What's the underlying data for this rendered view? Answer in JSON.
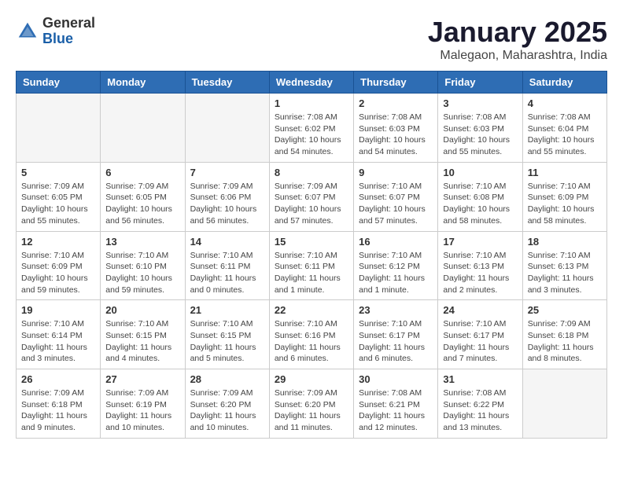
{
  "header": {
    "logo_general": "General",
    "logo_blue": "Blue",
    "title": "January 2025",
    "subtitle": "Malegaon, Maharashtra, India"
  },
  "days_of_week": [
    "Sunday",
    "Monday",
    "Tuesday",
    "Wednesday",
    "Thursday",
    "Friday",
    "Saturday"
  ],
  "weeks": [
    [
      {
        "day": "",
        "info": ""
      },
      {
        "day": "",
        "info": ""
      },
      {
        "day": "",
        "info": ""
      },
      {
        "day": "1",
        "info": "Sunrise: 7:08 AM\nSunset: 6:02 PM\nDaylight: 10 hours\nand 54 minutes."
      },
      {
        "day": "2",
        "info": "Sunrise: 7:08 AM\nSunset: 6:03 PM\nDaylight: 10 hours\nand 54 minutes."
      },
      {
        "day": "3",
        "info": "Sunrise: 7:08 AM\nSunset: 6:03 PM\nDaylight: 10 hours\nand 55 minutes."
      },
      {
        "day": "4",
        "info": "Sunrise: 7:08 AM\nSunset: 6:04 PM\nDaylight: 10 hours\nand 55 minutes."
      }
    ],
    [
      {
        "day": "5",
        "info": "Sunrise: 7:09 AM\nSunset: 6:05 PM\nDaylight: 10 hours\nand 55 minutes."
      },
      {
        "day": "6",
        "info": "Sunrise: 7:09 AM\nSunset: 6:05 PM\nDaylight: 10 hours\nand 56 minutes."
      },
      {
        "day": "7",
        "info": "Sunrise: 7:09 AM\nSunset: 6:06 PM\nDaylight: 10 hours\nand 56 minutes."
      },
      {
        "day": "8",
        "info": "Sunrise: 7:09 AM\nSunset: 6:07 PM\nDaylight: 10 hours\nand 57 minutes."
      },
      {
        "day": "9",
        "info": "Sunrise: 7:10 AM\nSunset: 6:07 PM\nDaylight: 10 hours\nand 57 minutes."
      },
      {
        "day": "10",
        "info": "Sunrise: 7:10 AM\nSunset: 6:08 PM\nDaylight: 10 hours\nand 58 minutes."
      },
      {
        "day": "11",
        "info": "Sunrise: 7:10 AM\nSunset: 6:09 PM\nDaylight: 10 hours\nand 58 minutes."
      }
    ],
    [
      {
        "day": "12",
        "info": "Sunrise: 7:10 AM\nSunset: 6:09 PM\nDaylight: 10 hours\nand 59 minutes."
      },
      {
        "day": "13",
        "info": "Sunrise: 7:10 AM\nSunset: 6:10 PM\nDaylight: 10 hours\nand 59 minutes."
      },
      {
        "day": "14",
        "info": "Sunrise: 7:10 AM\nSunset: 6:11 PM\nDaylight: 11 hours\nand 0 minutes."
      },
      {
        "day": "15",
        "info": "Sunrise: 7:10 AM\nSunset: 6:11 PM\nDaylight: 11 hours\nand 1 minute."
      },
      {
        "day": "16",
        "info": "Sunrise: 7:10 AM\nSunset: 6:12 PM\nDaylight: 11 hours\nand 1 minute."
      },
      {
        "day": "17",
        "info": "Sunrise: 7:10 AM\nSunset: 6:13 PM\nDaylight: 11 hours\nand 2 minutes."
      },
      {
        "day": "18",
        "info": "Sunrise: 7:10 AM\nSunset: 6:13 PM\nDaylight: 11 hours\nand 3 minutes."
      }
    ],
    [
      {
        "day": "19",
        "info": "Sunrise: 7:10 AM\nSunset: 6:14 PM\nDaylight: 11 hours\nand 3 minutes."
      },
      {
        "day": "20",
        "info": "Sunrise: 7:10 AM\nSunset: 6:15 PM\nDaylight: 11 hours\nand 4 minutes."
      },
      {
        "day": "21",
        "info": "Sunrise: 7:10 AM\nSunset: 6:15 PM\nDaylight: 11 hours\nand 5 minutes."
      },
      {
        "day": "22",
        "info": "Sunrise: 7:10 AM\nSunset: 6:16 PM\nDaylight: 11 hours\nand 6 minutes."
      },
      {
        "day": "23",
        "info": "Sunrise: 7:10 AM\nSunset: 6:17 PM\nDaylight: 11 hours\nand 6 minutes."
      },
      {
        "day": "24",
        "info": "Sunrise: 7:10 AM\nSunset: 6:17 PM\nDaylight: 11 hours\nand 7 minutes."
      },
      {
        "day": "25",
        "info": "Sunrise: 7:09 AM\nSunset: 6:18 PM\nDaylight: 11 hours\nand 8 minutes."
      }
    ],
    [
      {
        "day": "26",
        "info": "Sunrise: 7:09 AM\nSunset: 6:18 PM\nDaylight: 11 hours\nand 9 minutes."
      },
      {
        "day": "27",
        "info": "Sunrise: 7:09 AM\nSunset: 6:19 PM\nDaylight: 11 hours\nand 10 minutes."
      },
      {
        "day": "28",
        "info": "Sunrise: 7:09 AM\nSunset: 6:20 PM\nDaylight: 11 hours\nand 10 minutes."
      },
      {
        "day": "29",
        "info": "Sunrise: 7:09 AM\nSunset: 6:20 PM\nDaylight: 11 hours\nand 11 minutes."
      },
      {
        "day": "30",
        "info": "Sunrise: 7:08 AM\nSunset: 6:21 PM\nDaylight: 11 hours\nand 12 minutes."
      },
      {
        "day": "31",
        "info": "Sunrise: 7:08 AM\nSunset: 6:22 PM\nDaylight: 11 hours\nand 13 minutes."
      },
      {
        "day": "",
        "info": ""
      }
    ]
  ]
}
